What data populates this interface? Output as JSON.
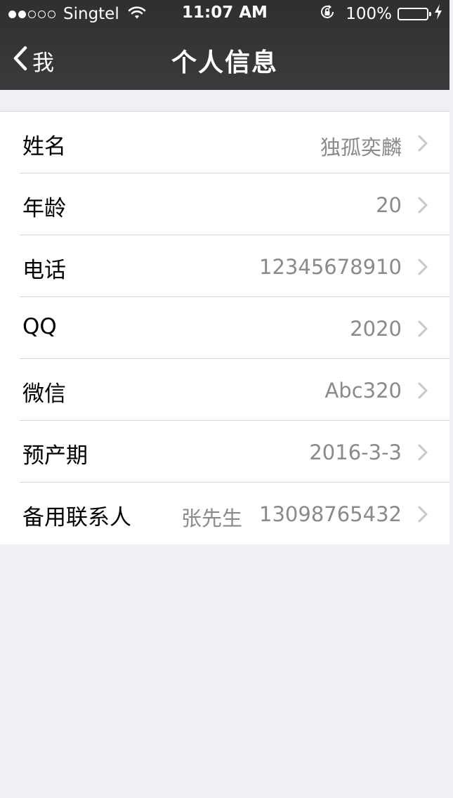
{
  "status_bar": {
    "signal_filled": 2,
    "signal_total": 5,
    "carrier": "Singtel",
    "time": "11:07 AM",
    "battery": "100%",
    "battery_color": "#4cd964"
  },
  "nav": {
    "back_label": "我",
    "title": "个人信息",
    "bar_color": "#333335"
  },
  "rows": [
    {
      "label": "姓名",
      "value": "独孤奕麟"
    },
    {
      "label": "年龄",
      "value": "20"
    },
    {
      "label": "电话",
      "value": "12345678910"
    },
    {
      "label": "QQ",
      "value": "2020"
    },
    {
      "label": "微信",
      "value": "Abc320"
    },
    {
      "label": "预产期",
      "value": "2016-3-3"
    },
    {
      "label": "备用联系人",
      "contact_name": "张先生",
      "value": "13098765432"
    }
  ],
  "icons": {
    "back": "chevron-left-icon",
    "disclosure": "chevron-right-icon",
    "wifi": "wifi-icon",
    "rotation_lock": "rotation-lock-icon",
    "charging": "bolt-icon"
  }
}
